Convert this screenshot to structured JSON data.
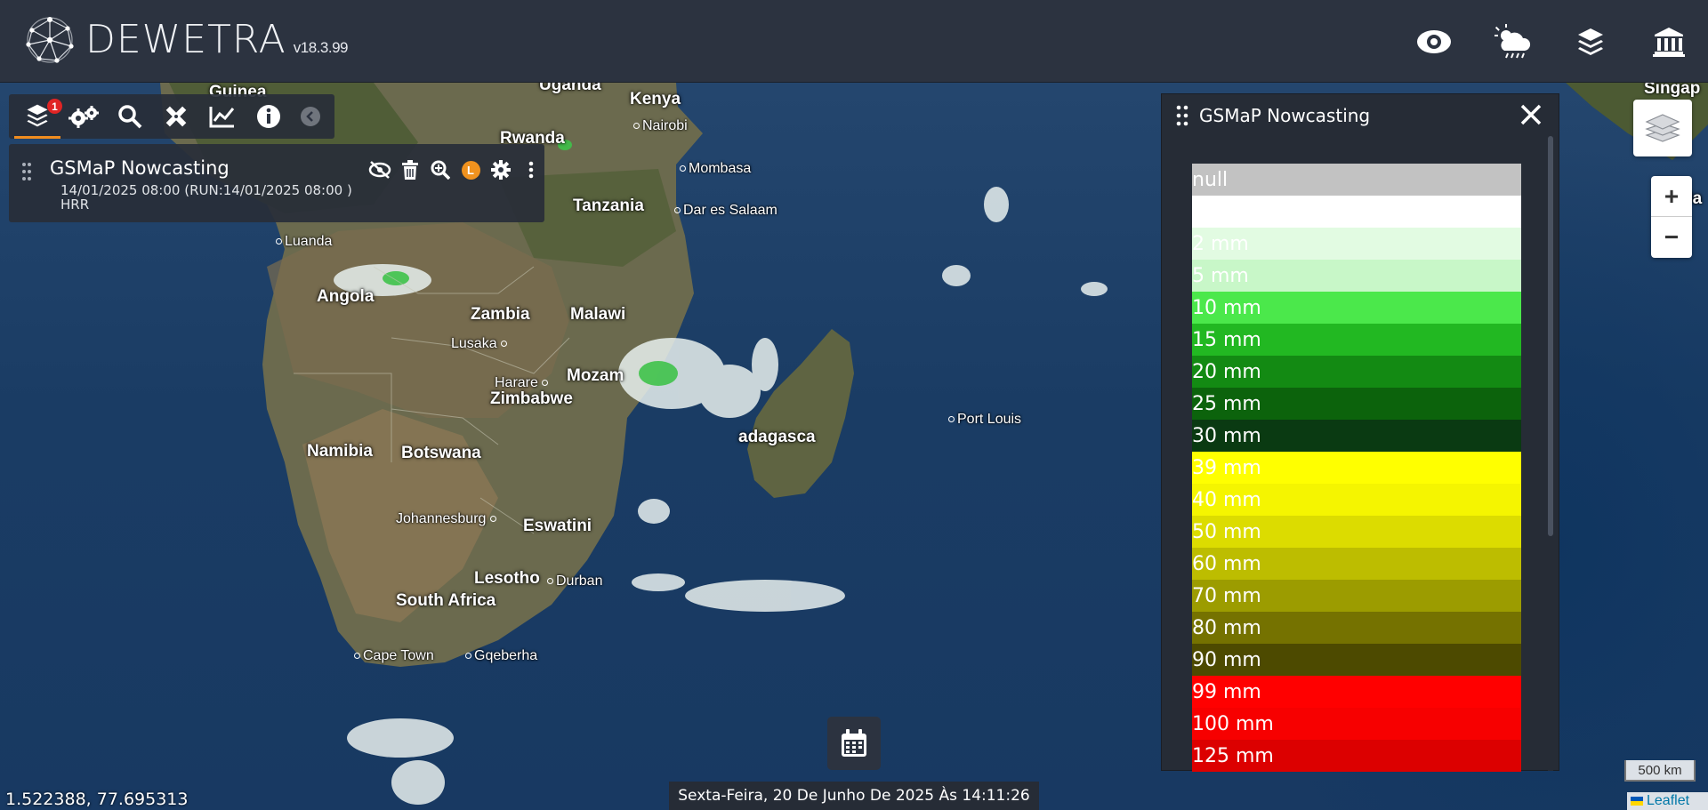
{
  "header": {
    "app_name": "DEWETRA",
    "version": "v18.3.99",
    "icons": [
      "eye-icon",
      "weather-icon",
      "layers-icon",
      "institution-icon"
    ]
  },
  "toolbar": {
    "layers_badge": "1",
    "icons": [
      "layers-icon",
      "settings-icon",
      "search-icon",
      "tools-icon",
      "chart-icon",
      "info-icon",
      "chevron-left-icon"
    ]
  },
  "layer": {
    "name": "GSMaP Nowcasting",
    "date": "14/01/2025 08:00 (RUN:14/01/2025 08:00 )",
    "model": "HRR",
    "legend_badge": "L"
  },
  "legend": {
    "title": "GSMaP Nowcasting",
    "entries": [
      {
        "label": "null",
        "color": "#c2c2c2",
        "text_color": "#ffffff"
      },
      {
        "label": "",
        "color": "#ffffff",
        "text_color": "#ffffff"
      },
      {
        "label": "2 mm",
        "color": "#e2fbe2",
        "text_color": "#ffffff"
      },
      {
        "label": "5 mm",
        "color": "#c8f7c8",
        "text_color": "#ffffff"
      },
      {
        "label": "10 mm",
        "color": "#4be84b",
        "text_color": "#ffffff"
      },
      {
        "label": "15 mm",
        "color": "#22b822",
        "text_color": "#ffffff"
      },
      {
        "label": "20 mm",
        "color": "#138a13",
        "text_color": "#ffffff"
      },
      {
        "label": "25 mm",
        "color": "#0c630c",
        "text_color": "#ffffff"
      },
      {
        "label": "30 mm",
        "color": "#0a3a12",
        "text_color": "#ffffff"
      },
      {
        "label": "39 mm",
        "color": "#ffff00",
        "text_color": "#ffffff"
      },
      {
        "label": "40 mm",
        "color": "#f5f500",
        "text_color": "#ffffff"
      },
      {
        "label": "50 mm",
        "color": "#dcdc00",
        "text_color": "#ffffff"
      },
      {
        "label": "60 mm",
        "color": "#bdbd00",
        "text_color": "#ffffff"
      },
      {
        "label": "70 mm",
        "color": "#9c9c00",
        "text_color": "#ffffff"
      },
      {
        "label": "80 mm",
        "color": "#757200",
        "text_color": "#ffffff"
      },
      {
        "label": "90 mm",
        "color": "#4d4a00",
        "text_color": "#ffffff"
      },
      {
        "label": "99 mm",
        "color": "#ff0000",
        "text_color": "#ffffff"
      },
      {
        "label": "100 mm",
        "color": "#f70000",
        "text_color": "#ffffff"
      },
      {
        "label": "125 mm",
        "color": "#dc0000",
        "text_color": "#ffffff"
      }
    ]
  },
  "map": {
    "countries": [
      "Guinea",
      "Uganda",
      "Kenya",
      "Rwanda",
      "Tanzania",
      "Angola",
      "Zambia",
      "Malawi",
      "Mozam",
      "Zimbabwe",
      "Namibia",
      "Botswana",
      "adagasca",
      "Eswatini",
      "Lesotho",
      "South Africa",
      "Ja",
      "Singap"
    ],
    "cities": [
      "Nairobi",
      "Mombasa",
      "Dar es Salaam",
      "Luanda",
      "Lusaka",
      "Harare",
      "Port Louis",
      "Johannesburg",
      "Durban",
      "Cape Town",
      "Gqeberha"
    ],
    "coords": "1.522388, 77.695313",
    "scale": "500 km",
    "attribution": "Leaflet",
    "date_time": "Sexta-Feira, 20 De Junho De 2025 Às 14:11:26"
  }
}
